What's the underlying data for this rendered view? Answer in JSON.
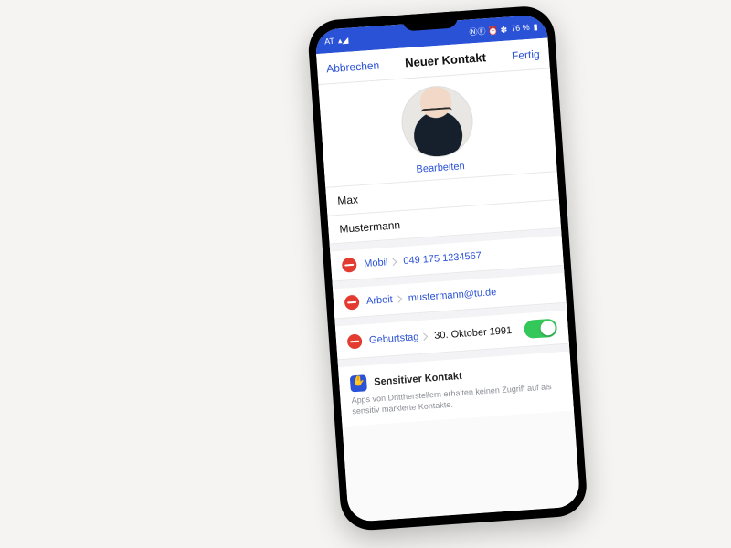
{
  "statusbar": {
    "carrier": "AT",
    "battery": "76 %",
    "icons": "ⓃⒻ ⏰ ✽"
  },
  "nav": {
    "cancel": "Abbrechen",
    "title": "Neuer Kontakt",
    "done": "Fertig"
  },
  "avatar": {
    "edit": "Bearbeiten"
  },
  "name": {
    "first": "Max",
    "last": "Mustermann"
  },
  "fields": {
    "phone": {
      "label": "Mobil",
      "value": "049 175 1234567"
    },
    "email": {
      "label": "Arbeit",
      "value": "mustermann@tu.de"
    },
    "birthday": {
      "label": "Geburtstag",
      "value": "30. Oktober 1991"
    }
  },
  "sensitive": {
    "title": "Sensitiver Kontakt",
    "desc": "Apps von Drittherstellern erhalten keinen Zugriff auf als sensitiv markierte Kontakte."
  }
}
